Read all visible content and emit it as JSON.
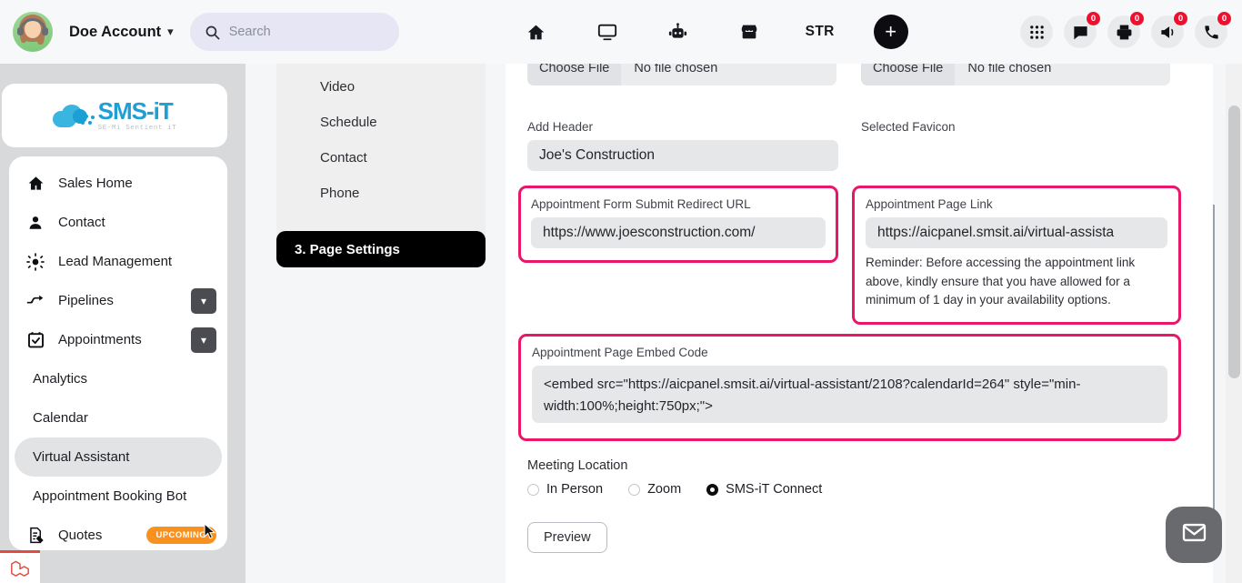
{
  "topbar": {
    "account_label": "Doe Account",
    "chevron_icon": "chevron-down-icon",
    "search": {
      "placeholder": "Search",
      "value": "",
      "icon": "search-icon"
    },
    "nav_icons": [
      {
        "name": "home-icon",
        "label": ""
      },
      {
        "name": "monitor-icon",
        "label": ""
      },
      {
        "name": "robot-icon",
        "label": ""
      },
      {
        "name": "store-icon",
        "label": ""
      },
      {
        "name": "str-text",
        "label": "STR"
      }
    ],
    "add_button_label": "+",
    "right_icons": [
      {
        "name": "apps-grid-icon",
        "badge": ""
      },
      {
        "name": "chat-icon",
        "badge": "0"
      },
      {
        "name": "printer-icon",
        "badge": "0"
      },
      {
        "name": "megaphone-icon",
        "badge": "0"
      },
      {
        "name": "phone-icon",
        "badge": "0"
      }
    ],
    "badge_color": "#ef0f2e"
  },
  "sidebar": {
    "logo": {
      "main": "SMS-iT",
      "sub": "SE-Mi Sentient iT",
      "color": "#1f9fd6"
    },
    "items": [
      {
        "label": "Sales Home",
        "icon": "home-icon",
        "expandable": false,
        "active": false,
        "sub": false
      },
      {
        "label": "Contact",
        "icon": "person-icon",
        "expandable": false,
        "active": false,
        "sub": false
      },
      {
        "label": "Lead Management",
        "icon": "lead-icon",
        "expandable": false,
        "active": false,
        "sub": false
      },
      {
        "label": "Pipelines",
        "icon": "pipeline-icon",
        "expandable": true,
        "active": false,
        "sub": false
      },
      {
        "label": "Appointments",
        "icon": "calendar-check-icon",
        "expandable": true,
        "active": false,
        "sub": false
      },
      {
        "label": "Analytics",
        "icon": "",
        "expandable": false,
        "active": false,
        "sub": true
      },
      {
        "label": "Calendar",
        "icon": "",
        "expandable": false,
        "active": false,
        "sub": true
      },
      {
        "label": "Virtual Assistant",
        "icon": "",
        "expandable": false,
        "active": true,
        "sub": true
      },
      {
        "label": "Appointment Booking Bot",
        "icon": "",
        "expandable": false,
        "active": false,
        "sub": true
      },
      {
        "label": "Quotes",
        "icon": "quote-doc-icon",
        "expandable": false,
        "active": false,
        "sub": false,
        "badge": "UPCOMING"
      }
    ],
    "badge_color": "#f8911d"
  },
  "stepnav": {
    "items": [
      {
        "label": "Video"
      },
      {
        "label": "Schedule"
      },
      {
        "label": "Contact"
      },
      {
        "label": "Phone"
      }
    ],
    "current": "3. Page Settings"
  },
  "form": {
    "file_left": {
      "button": "Choose File",
      "status": "No file chosen"
    },
    "file_right": {
      "button": "Choose File",
      "status": "No file chosen"
    },
    "add_header": {
      "label": "Add Header",
      "value": "Joe's Construction"
    },
    "selected_favicon": {
      "label": "Selected Favicon"
    },
    "redirect_url": {
      "label": "Appointment Form Submit Redirect URL",
      "value": "https://www.joesconstruction.com/",
      "highlighted": true
    },
    "page_link": {
      "label": "Appointment Page Link",
      "value": "https://aicpanel.smsit.ai/virtual-assista",
      "reminder": "Reminder: Before accessing the appointment link above, kindly ensure that you have allowed for a minimum of 1 day in your availability options.",
      "highlighted": true
    },
    "embed_code": {
      "label": "Appointment Page Embed Code",
      "value": "<embed src=\"https://aicpanel.smsit.ai/virtual-assistant/2108?calendarId=264\" style=\"min-width:100%;height:750px;\">",
      "highlighted": true
    },
    "meeting_location": {
      "label": "Meeting Location",
      "options": [
        {
          "label": "In Person",
          "selected": false
        },
        {
          "label": "Zoom",
          "selected": false
        },
        {
          "label": "SMS-iT Connect",
          "selected": true
        }
      ]
    },
    "preview_button": "Preview",
    "highlight_color": "#e8176a"
  },
  "chat_widget": {
    "icon": "envelope-icon"
  }
}
